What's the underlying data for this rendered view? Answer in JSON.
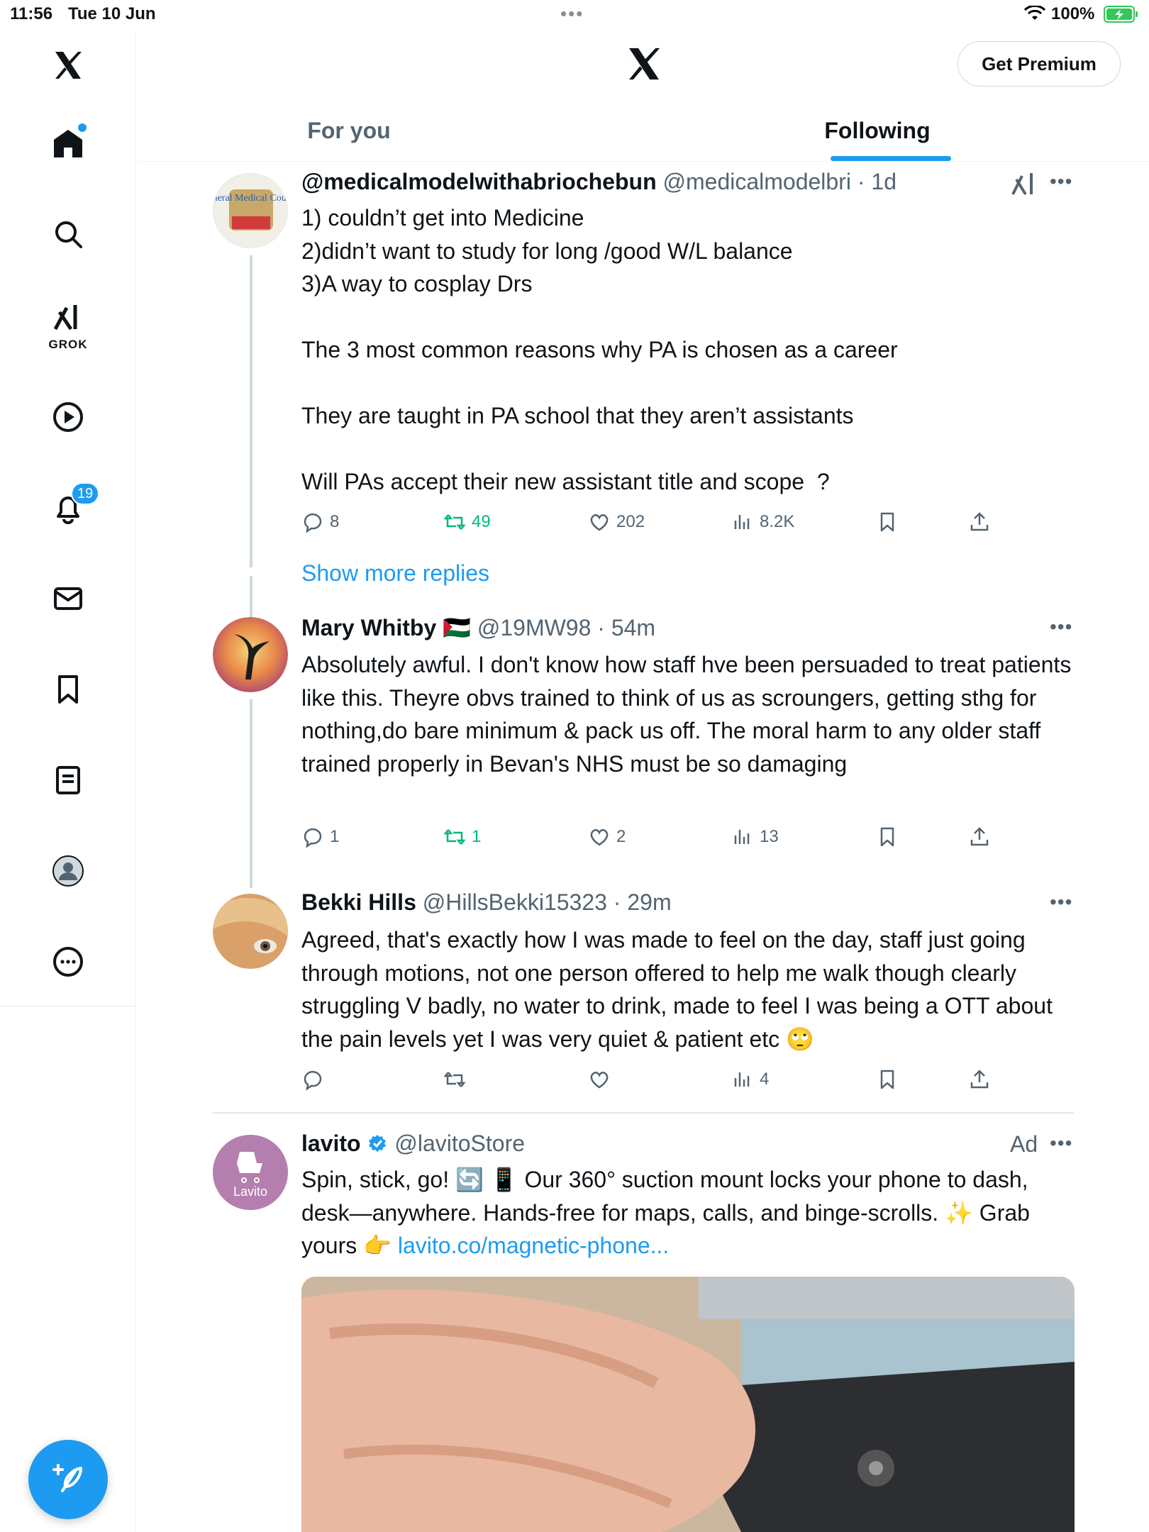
{
  "status_bar": {
    "time": "11:56",
    "date": "Tue 10 Jun",
    "battery_pct": "100%",
    "battery_color": "#34c759"
  },
  "sidebar": {
    "logo_icon": "x-logo-icon",
    "items": [
      {
        "icon": "home-icon"
      },
      {
        "icon": "search-icon"
      },
      {
        "icon": "grok-icon",
        "label": "GROK"
      },
      {
        "icon": "video-play-icon"
      },
      {
        "icon": "bell-icon",
        "badge": "19"
      },
      {
        "icon": "mail-icon"
      },
      {
        "icon": "bookmark-icon"
      },
      {
        "icon": "document-icon"
      },
      {
        "icon": "profile-icon"
      },
      {
        "icon": "more-circle-icon"
      }
    ]
  },
  "header": {
    "premium_label": "Get Premium",
    "tabs": [
      {
        "label": "For you"
      },
      {
        "label": "Following"
      }
    ],
    "accent": "#1d9bf0"
  },
  "posts": [
    {
      "name": "@medicalmodelwithabriochebun",
      "handle": "@medicalmodelbri",
      "sep": " · ",
      "time": "1d",
      "avatar_text": "General Medical Council",
      "body": "1) couldn’t get into Medicine\n2)didn’t want to study for long /good W/L balance\n3)A way to cosplay Drs\n\nThe 3 most common reasons why PA is chosen as a career\n\nThey are taught in PA school that they aren’t assistants\n\nWill PAs accept their new assistant title and scope  ?",
      "replies": "8",
      "reposts": "49",
      "likes": "202",
      "views": "8.2K"
    },
    {
      "name": "Mary Whitby 🇵🇸",
      "handle": "@19MW98",
      "sep": " · ",
      "time": "54m",
      "body": "Absolutely awful. I don't know how staff hve been persuaded to treat patients like this. Theyre obvs trained to think of us as scroungers, getting sthg for nothing,do bare minimum & pack us off. The moral harm to any older staff trained properly in Bevan's NHS must be so damaging",
      "replies": "1",
      "reposts": "1",
      "likes": "2",
      "views": "13"
    },
    {
      "name": "Bekki Hills",
      "handle": "@HillsBekki15323",
      "sep": " · ",
      "time": "29m",
      "body": "Agreed, that's exactly how I was made to feel on the day, staff just going through motions, not one person offered to help me walk though clearly struggling V badly, no water to drink, made to feel I was being a OTT about the pain levels yet I was very quiet & patient etc 🙄",
      "replies": "",
      "reposts": "",
      "likes": "",
      "views": "4"
    }
  ],
  "show_more": "Show more replies",
  "ad": {
    "name": "lavito",
    "handle": "@lavitoStore",
    "ad_label": "Ad",
    "avatar_text": "Lavito",
    "avatar_color": "#b47fae",
    "verified_color": "#1d9bf0",
    "body_text": "Spin, stick, go! 🔄 📱 Our 360° suction mount locks your phone to dash, desk—anywhere. Hands-free for maps, calls, and binge-scrolls. ✨ Grab yours 👉 ",
    "link": "lavito.co/magnetic-phone..."
  }
}
